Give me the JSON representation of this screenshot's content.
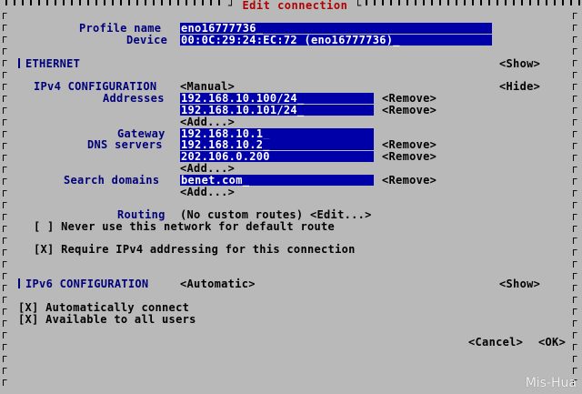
{
  "window": {
    "title": "Edit connection"
  },
  "profile": {
    "profile_name_label": "Profile name",
    "profile_name_value": "eno16777736_",
    "device_label": "Device",
    "device_value": "00:0C:29:24:EC:72 (eno16777736)_"
  },
  "ethernet": {
    "label": "ETHERNET",
    "toggle": "<Show>"
  },
  "ipv4": {
    "label": "IPv4 CONFIGURATION",
    "method": "<Manual>",
    "toggle": "<Hide>",
    "addresses_label": "Addresses",
    "addresses": [
      "192.168.10.100/24_",
      "192.168.10.101/24_"
    ],
    "add_label": "<Add...>",
    "remove_label": "<Remove>",
    "gateway_label": "Gateway",
    "gateway_value": "192.168.10.1_",
    "dns_label": "DNS servers",
    "dns": [
      "192.168.10.2_",
      "202.106.0.200"
    ],
    "search_label": "Search domains",
    "search": [
      "benet.com_"
    ],
    "routing_label": "Routing",
    "routing_value": "(No custom routes) <Edit...>",
    "never_default": "[ ] Never use this network for default route",
    "require_ipv4": "[X] Require IPv4 addressing for this connection"
  },
  "ipv6": {
    "label": "IPv6 CONFIGURATION",
    "method": "<Automatic>",
    "toggle": "<Show>"
  },
  "options": {
    "auto_connect": "[X] Automatically connect",
    "all_users": "[X] Available to all users"
  },
  "buttons": {
    "cancel": "<Cancel>",
    "ok": "<OK>"
  },
  "watermark": "Mis-Hua"
}
